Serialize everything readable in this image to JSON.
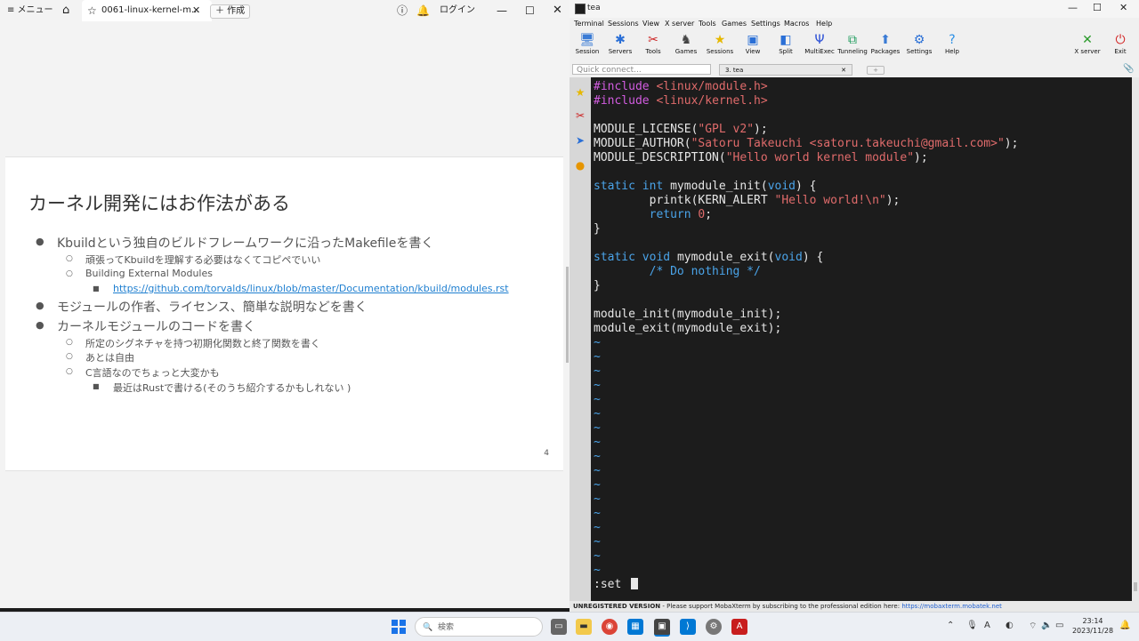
{
  "left_window": {
    "titlebar": {
      "menu_label": "≡ メニュー",
      "tab_title": "0061-linux-kernel-m...",
      "new_button": "＋ 作成",
      "login_label": "ログイン"
    },
    "slide": {
      "title": "カーネル開発にはお作法がある",
      "bullets": [
        {
          "level": 1,
          "text": "Kbuildという独自のビルドフレームワークに沿ったMakefileを書く"
        },
        {
          "level": 2,
          "text": "頑張ってKbuildを理解する必要はなくてコピペでいい"
        },
        {
          "level": 2,
          "text": "Building External Modules"
        },
        {
          "level": 3,
          "text": "https://github.com/torvalds/linux/blob/master/Documentation/kbuild/modules.rst",
          "link": true
        },
        {
          "level": 1,
          "text": "モジュールの作者、ライセンス、簡単な説明などを書く"
        },
        {
          "level": 1,
          "text": "カーネルモジュールのコードを書く"
        },
        {
          "level": 2,
          "text": "所定のシグネチャを持つ初期化関数と終了関数を書く"
        },
        {
          "level": 2,
          "text": "あとは自由"
        },
        {
          "level": 2,
          "text": "C言語なのでちょっと大変かも"
        },
        {
          "level": 3,
          "text": "最近はRustで書ける(そのうち紹介するかもしれない )"
        }
      ],
      "page_number": "4"
    }
  },
  "right_window": {
    "title": "tea",
    "menu": [
      "Terminal",
      "Sessions",
      "View",
      "X server",
      "Tools",
      "Games",
      "Settings",
      "Macros",
      "Help"
    ],
    "toolbar": [
      {
        "label": "Session",
        "icon": "session-icon",
        "glyph": "🖥",
        "color": "#3a7bd5"
      },
      {
        "label": "Servers",
        "icon": "servers-icon",
        "glyph": "✱",
        "color": "#2a6fd6"
      },
      {
        "label": "Tools",
        "icon": "tools-icon",
        "glyph": "✂",
        "color": "#cc2222"
      },
      {
        "label": "Games",
        "icon": "games-icon",
        "glyph": "♞",
        "color": "#444444"
      },
      {
        "label": "Sessions",
        "icon": "star-icon",
        "glyph": "★",
        "color": "#e6b800"
      },
      {
        "label": "View",
        "icon": "view-icon",
        "glyph": "▣",
        "color": "#2a6fd6"
      },
      {
        "label": "Split",
        "icon": "split-icon",
        "glyph": "◧",
        "color": "#2a6fd6"
      },
      {
        "label": "MultiExec",
        "icon": "multiexec-icon",
        "glyph": "Ψ",
        "color": "#2a4fd6"
      },
      {
        "label": "Tunneling",
        "icon": "tunneling-icon",
        "glyph": "⧉",
        "color": "#1a9a5a"
      },
      {
        "label": "Packages",
        "icon": "packages-icon",
        "glyph": "⬆",
        "color": "#3a7bd5"
      },
      {
        "label": "Settings",
        "icon": "settings-icon",
        "glyph": "⚙",
        "color": "#2a6fd6"
      },
      {
        "label": "Help",
        "icon": "help-icon",
        "glyph": "?",
        "color": "#2a8fe6"
      },
      {
        "label": "X server",
        "icon": "xserver-icon",
        "glyph": "✕",
        "color": "#2a9a2a"
      },
      {
        "label": "Exit",
        "icon": "power-icon",
        "glyph": "⏻",
        "color": "#d22222"
      }
    ],
    "quick_connect_placeholder": "Quick connect...",
    "session_tab": "3. tea",
    "terminal_lines": [
      [
        {
          "t": "#include ",
          "c": "kw-pre"
        },
        {
          "t": "<linux/module.h>",
          "c": "str"
        }
      ],
      [
        {
          "t": "#include ",
          "c": "kw-pre"
        },
        {
          "t": "<linux/kernel.h>",
          "c": "str"
        }
      ],
      [],
      [
        {
          "t": "MODULE_LICENSE(",
          "c": ""
        },
        {
          "t": "\"GPL v2\"",
          "c": "str"
        },
        {
          "t": ");",
          "c": ""
        }
      ],
      [
        {
          "t": "MODULE_AUTHOR(",
          "c": ""
        },
        {
          "t": "\"Satoru Takeuchi <satoru.takeuchi@gmail.com>\"",
          "c": "str"
        },
        {
          "t": ");",
          "c": ""
        }
      ],
      [
        {
          "t": "MODULE_DESCRIPTION(",
          "c": ""
        },
        {
          "t": "\"Hello world kernel module\"",
          "c": "str"
        },
        {
          "t": ");",
          "c": ""
        }
      ],
      [],
      [
        {
          "t": "static ",
          "c": "kw"
        },
        {
          "t": "int ",
          "c": "kw"
        },
        {
          "t": "mymodule_init(",
          "c": ""
        },
        {
          "t": "void",
          "c": "kw"
        },
        {
          "t": ") {",
          "c": ""
        }
      ],
      [
        {
          "t": "        printk(KERN_ALERT ",
          "c": ""
        },
        {
          "t": "\"Hello world!\\n\"",
          "c": "str"
        },
        {
          "t": ");",
          "c": ""
        }
      ],
      [
        {
          "t": "        return ",
          "c": "kw"
        },
        {
          "t": "0",
          "c": "num"
        },
        {
          "t": ";",
          "c": ""
        }
      ],
      [
        {
          "t": "}",
          "c": ""
        }
      ],
      [],
      [
        {
          "t": "static ",
          "c": "kw"
        },
        {
          "t": "void ",
          "c": "kw"
        },
        {
          "t": "mymodule_exit(",
          "c": ""
        },
        {
          "t": "void",
          "c": "kw"
        },
        {
          "t": ") {",
          "c": ""
        }
      ],
      [
        {
          "t": "        /* Do nothing */",
          "c": "cmt"
        }
      ],
      [
        {
          "t": "}",
          "c": ""
        }
      ],
      [],
      [
        {
          "t": "module_init(mymodule_init);",
          "c": ""
        }
      ],
      [
        {
          "t": "module_exit(mymodule_exit);",
          "c": ""
        }
      ]
    ],
    "tilde_lines": 17,
    "command_line": ":set ",
    "status_bar": {
      "strong": "UNREGISTERED VERSION",
      "text": "  -  Please support MobaXterm by subscribing to the professional edition here:  ",
      "link": "https://mobaxterm.mobatek.net"
    }
  },
  "taskbar": {
    "search_placeholder": "検索",
    "time": "23:14",
    "date": "2023/11/28",
    "ime": "A"
  }
}
